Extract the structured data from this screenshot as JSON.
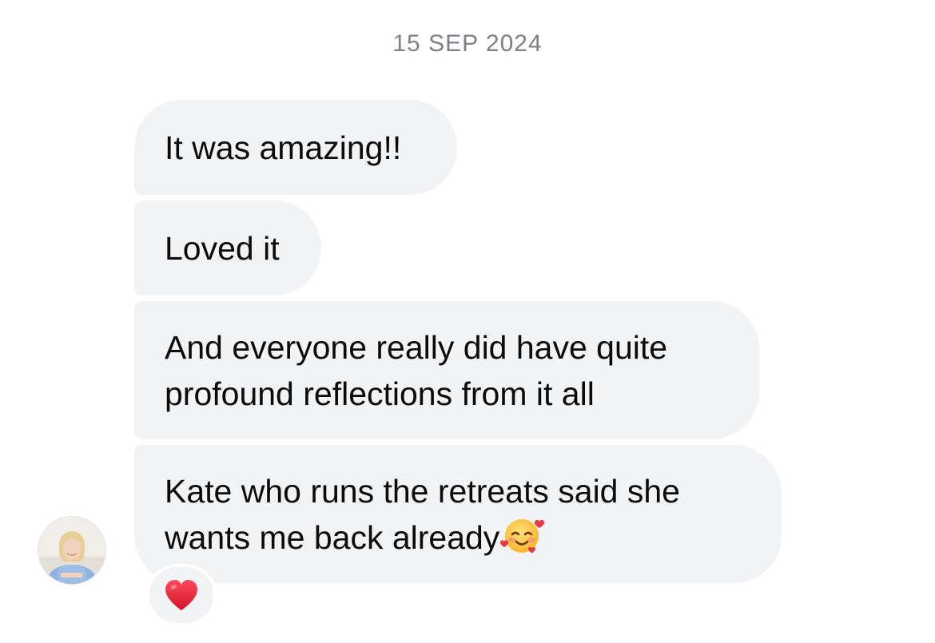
{
  "conversation": {
    "date_separator": "15 SEP 2024",
    "messages": [
      {
        "text": "It was amazing!!"
      },
      {
        "text": "Loved it"
      },
      {
        "text": "And everyone really did have quite profound reflections from it all"
      },
      {
        "text": "Kate who runs the retreats said she wants me back already",
        "emoji": "smiling-face-with-hearts"
      }
    ],
    "reaction": {
      "emoji": "red-heart"
    }
  },
  "colors": {
    "bubble": "#f2f3f5",
    "text": "#0b0b0b",
    "date": "#7d8085",
    "heart": "#e0243a"
  }
}
